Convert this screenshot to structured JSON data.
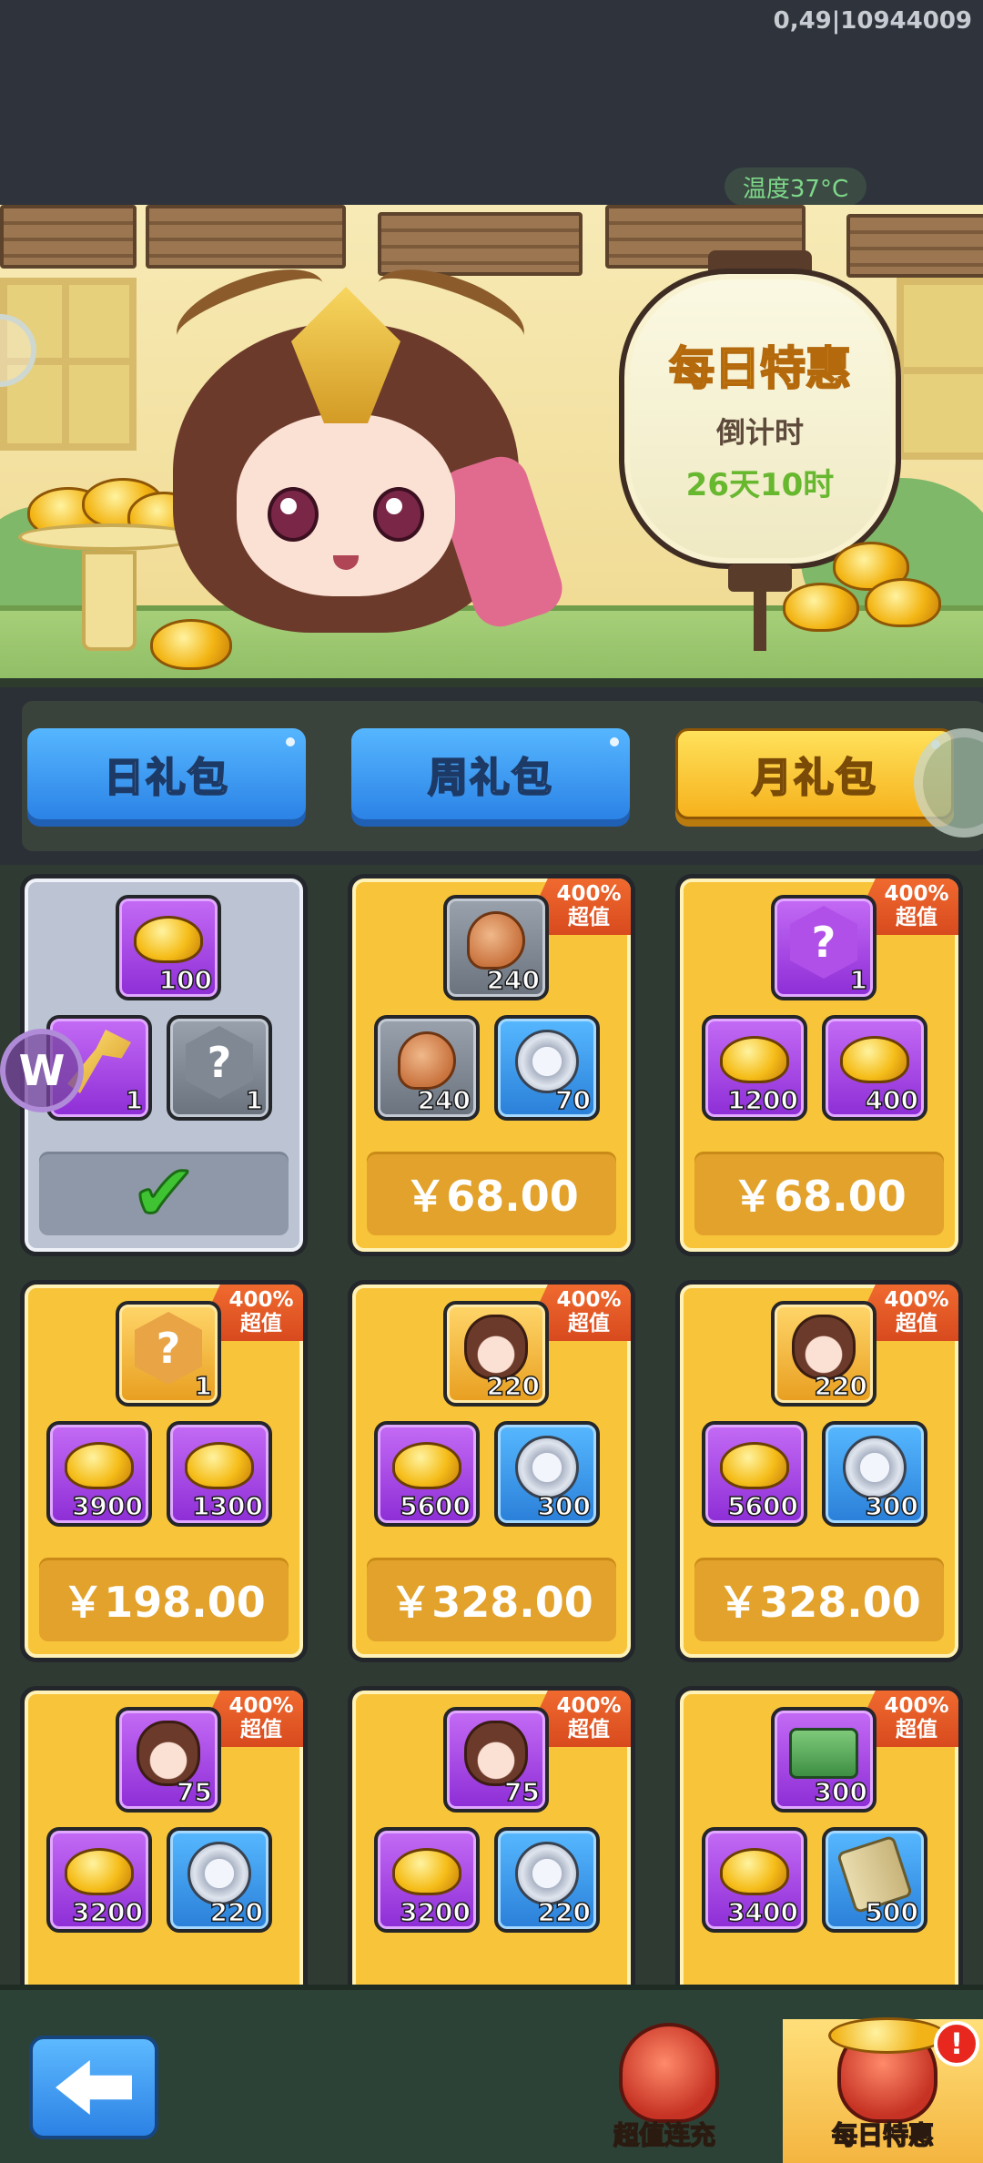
{
  "status": {
    "debug": "0,49|10944009",
    "temperature": "温度37°C"
  },
  "banner": {
    "title": "每日特惠",
    "countdown_label": "倒计时",
    "countdown_value": "26天10时"
  },
  "tabs": [
    {
      "label": "日礼包",
      "active": false
    },
    {
      "label": "周礼包",
      "active": false
    },
    {
      "label": "月礼包",
      "active": true
    }
  ],
  "colors": {
    "accent_gold": "#f8c43a",
    "badge": "#e55a24",
    "tab_blue": "#2b83e6",
    "bottom_bar": "#2d4236"
  },
  "packs": [
    {
      "badge": "",
      "purchased": true,
      "price": "",
      "items": [
        {
          "icon": "gold-ingot",
          "qty": "100",
          "style": "purple"
        },
        {
          "icon": "golden-key",
          "qty": "1",
          "style": "purple"
        },
        {
          "icon": "mystery-hex-grey",
          "qty": "1",
          "style": "grey"
        }
      ]
    },
    {
      "badge": "400%超值",
      "purchased": false,
      "price": "￥68.00",
      "items": [
        {
          "icon": "meat",
          "qty": "240",
          "style": "grey"
        },
        {
          "icon": "meat",
          "qty": "240",
          "style": "grey"
        },
        {
          "icon": "silver-coin",
          "qty": "70",
          "style": "blue"
        }
      ]
    },
    {
      "badge": "400%超值",
      "purchased": false,
      "price": "￥68.00",
      "items": [
        {
          "icon": "mystery-hex-purple",
          "qty": "1",
          "style": "purple"
        },
        {
          "icon": "gold-ingot",
          "qty": "1200",
          "style": "purple"
        },
        {
          "icon": "gold-ingot",
          "qty": "400",
          "style": "purple"
        }
      ]
    },
    {
      "badge": "400%超值",
      "purchased": false,
      "price": "￥198.00",
      "items": [
        {
          "icon": "mystery-hex-orange",
          "qty": "1",
          "style": "gold"
        },
        {
          "icon": "gold-ingot",
          "qty": "3900",
          "style": "purple"
        },
        {
          "icon": "gold-ingot",
          "qty": "1300",
          "style": "purple"
        }
      ]
    },
    {
      "badge": "400%超值",
      "purchased": false,
      "price": "￥328.00",
      "items": [
        {
          "icon": "hero-portrait",
          "qty": "220",
          "style": "gold"
        },
        {
          "icon": "gold-ingot",
          "qty": "5600",
          "style": "purple"
        },
        {
          "icon": "silver-coin",
          "qty": "300",
          "style": "blue"
        }
      ]
    },
    {
      "badge": "400%超值",
      "purchased": false,
      "price": "￥328.00",
      "items": [
        {
          "icon": "hero-portrait",
          "qty": "220",
          "style": "gold"
        },
        {
          "icon": "gold-ingot",
          "qty": "5600",
          "style": "purple"
        },
        {
          "icon": "silver-coin",
          "qty": "300",
          "style": "blue"
        }
      ]
    },
    {
      "badge": "400%超值",
      "purchased": false,
      "price": "",
      "items": [
        {
          "icon": "hero-portrait",
          "qty": "75",
          "style": "purple"
        },
        {
          "icon": "gold-ingot",
          "qty": "3200",
          "style": "purple"
        },
        {
          "icon": "silver-coin",
          "qty": "220",
          "style": "blue"
        }
      ]
    },
    {
      "badge": "400%超值",
      "purchased": false,
      "price": "",
      "items": [
        {
          "icon": "hero-portrait",
          "qty": "75",
          "style": "purple"
        },
        {
          "icon": "gold-ingot",
          "qty": "3200",
          "style": "purple"
        },
        {
          "icon": "silver-coin",
          "qty": "220",
          "style": "blue"
        }
      ]
    },
    {
      "badge": "400%超值",
      "purchased": false,
      "price": "",
      "items": [
        {
          "icon": "jade-seal",
          "qty": "300",
          "style": "purple"
        },
        {
          "icon": "gold-ingot",
          "qty": "3400",
          "style": "purple"
        },
        {
          "icon": "scroll",
          "qty": "500",
          "style": "blue"
        }
      ]
    }
  ],
  "bottom_nav": {
    "back_icon": "back-arrow-icon",
    "items": [
      {
        "label": "超值连充",
        "icon": "fortune-bag-icon",
        "active": false
      },
      {
        "label": "每日特惠",
        "icon": "gift-bag-icon",
        "active": true
      }
    ],
    "alert": "!"
  }
}
